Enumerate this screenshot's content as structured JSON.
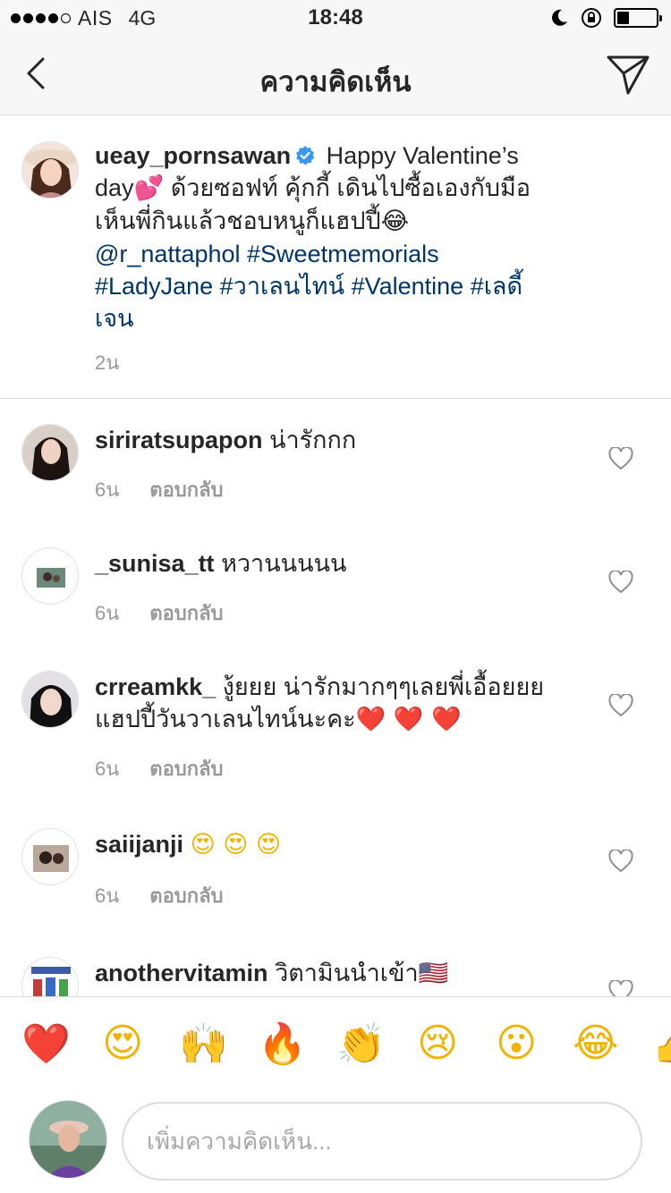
{
  "status": {
    "carrier": "AIS",
    "network": "4G",
    "time": "18:48",
    "signal_bars_filled": 4,
    "signal_bars_total": 5,
    "battery_level": 0.3
  },
  "nav": {
    "title": "ความคิดเห็น",
    "back_icon": "chevron-left-icon",
    "send_icon": "paper-plane-icon"
  },
  "caption": {
    "username": "ueay_pornsawan",
    "text1": "Happy Valentine’s day",
    "emoji1": "💕",
    "text2": "ด้วยซอฟท์ คุ้กกี้ เดินไปซื้อเองกับมือ เห็นพี่กินแล้วชอบหนูก็แฮปปี้",
    "emoji2": "😂",
    "mention": "@r_nattaphol",
    "tag1": "#Sweetmemorials",
    "tag2": "#LadyJane",
    "tag3": "#วาเลนไทน์",
    "tag4": "#Valentine",
    "tag5": "#เลดี้เจน",
    "time": "2น"
  },
  "comments": [
    {
      "username": "siriratsupapon",
      "text": "น่ารักกก",
      "time": "6น",
      "reply": "ตอบกลับ"
    },
    {
      "username": "_sunisa_tt",
      "text": "หวานนนนน",
      "time": "6น",
      "reply": "ตอบกลับ"
    },
    {
      "username": "crreamkk_",
      "text": "งู้ยยย น่ารักมากๆๆเลยพี่เอื้อยยย แฮปปี้วันวาเลนไทน์นะคะ",
      "emoji": "❤️ ❤️ ❤️",
      "time": "6น",
      "reply": "ตอบกลับ"
    },
    {
      "username": "saiijanji",
      "text": "",
      "emoji": "😍 😍 😍",
      "time": "6น",
      "reply": "ตอบกลับ"
    },
    {
      "username": "anothervitamin",
      "text": "วิตามินนำเข้า",
      "emoji": "🇺🇸"
    }
  ],
  "emoji_bar": [
    "❤️",
    "😍",
    "🙌",
    "🔥",
    "👏",
    "😢",
    "😮",
    "😂",
    "👍"
  ],
  "composer": {
    "placeholder": "เพิ่มความคิดเห็น..."
  },
  "colors": {
    "link": "#003569",
    "meta": "#999999",
    "verified": "#3897f0",
    "bar_bg": "#f7f7f7"
  }
}
